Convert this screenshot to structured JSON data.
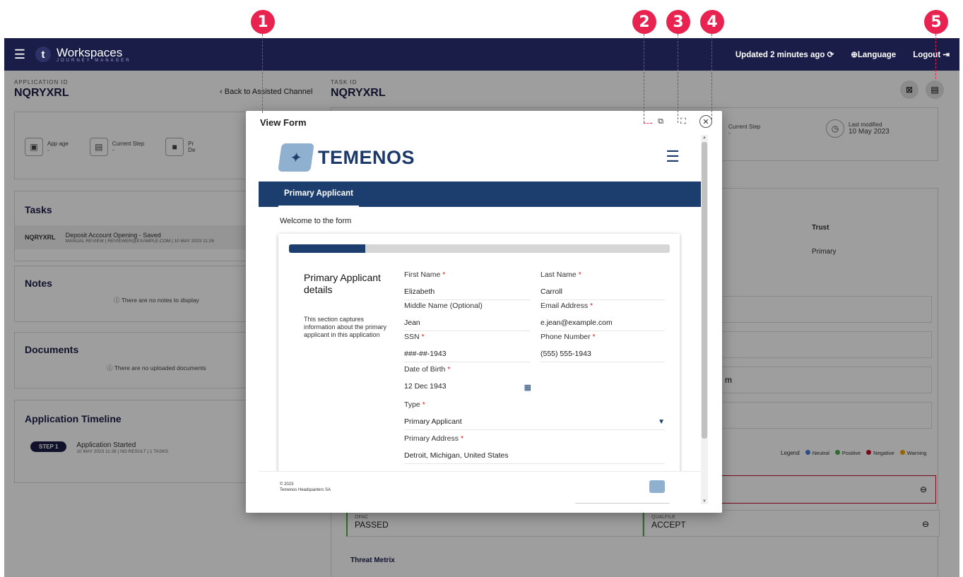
{
  "callouts": [
    "1",
    "2",
    "3",
    "4",
    "5"
  ],
  "topbar": {
    "brand_letter": "t",
    "brand_name": "Workspaces",
    "brand_sub": "JOURNEY MANAGER",
    "updated": "Updated 2 minutes ago",
    "language": "Language",
    "logout": "Logout"
  },
  "left": {
    "app_id_label": "APPLICATION ID",
    "app_id": "NQRYXRL",
    "back_link": "Back to Assisted Channel",
    "stats": [
      {
        "label": "App age",
        "value": "-"
      },
      {
        "label": "Current Step",
        "value": "-"
      },
      {
        "label": "Pr",
        "value": "De"
      }
    ],
    "tasks_title": "Tasks",
    "task": {
      "id": "NQRYXRL",
      "name": "Deposit Account Opening - Saved",
      "meta": "MANUAL REVIEW | REVIEWER@EXAMPLE.COM | 10 MAY 2023 11:26"
    },
    "notes_title": "Notes",
    "notes_empty": "There are no notes to display",
    "documents_title": "Documents",
    "documents_empty": "There are no uploaded documents",
    "timeline_title": "Application Timeline",
    "timeline": {
      "step": "STEP 1",
      "title": "Application Started",
      "meta": "10 MAY 2023 11:26 | NO RESULT | 1 TASKS"
    }
  },
  "right": {
    "task_id_label": "TASK ID",
    "task_id": "NQRYXRL",
    "current_step_label": "Current Step",
    "current_step_value": "-",
    "last_modified_label": "Last modified",
    "last_modified_value": "10 May 2023",
    "col_trust": "Trust",
    "col_primary": "Primary",
    "partial_text": "m",
    "legend": {
      "title": "Legend",
      "neutral": "Neutral",
      "positive": "Positive",
      "negative": "Negative",
      "warning": "Warning"
    },
    "colors": {
      "neutral": "#4a7fd4",
      "positive": "#4caf50",
      "negative": "#c0102a",
      "warning": "#f0a500"
    },
    "ofac_key": "OFAC",
    "ofac_val": "PASSED",
    "qualfile_key": "QUALFILE",
    "qualfile_val": "ACCEPT",
    "threat_title": "Threat Metrix"
  },
  "dialog": {
    "title": "View Form",
    "icons": [
      "open-external-icon",
      "fullscreen-icon",
      "close-icon"
    ]
  },
  "form": {
    "brand": "TEMENOS",
    "tab": "Primary Applicant",
    "welcome": "Welcome to the form",
    "progress_fraction": 0.2,
    "section_title": "Primary Applicant details",
    "section_desc": "This section captures information about the primary applicant in this application",
    "fields": {
      "first_name": {
        "label": "First Name",
        "value": "Elizabeth"
      },
      "last_name": {
        "label": "Last Name",
        "value": "Carroll"
      },
      "middle_name": {
        "label": "Middle Name (Optional)",
        "value": "Jean"
      },
      "email": {
        "label": "Email Address",
        "value": "e.jean@example.com"
      },
      "ssn": {
        "label": "SSN",
        "value": "###-##-1943"
      },
      "phone": {
        "label": "Phone Number",
        "value": "(555) 555-1943"
      },
      "dob": {
        "label": "Date of Birth",
        "value": "12 Dec 1943"
      },
      "type": {
        "label": "Type",
        "value": "Primary Applicant"
      },
      "address": {
        "label": "Primary Address",
        "value": "Detroit, Michigan, United States"
      }
    },
    "footer_copy": "© 2023",
    "footer_company": "Temenos Headquarters SA"
  }
}
